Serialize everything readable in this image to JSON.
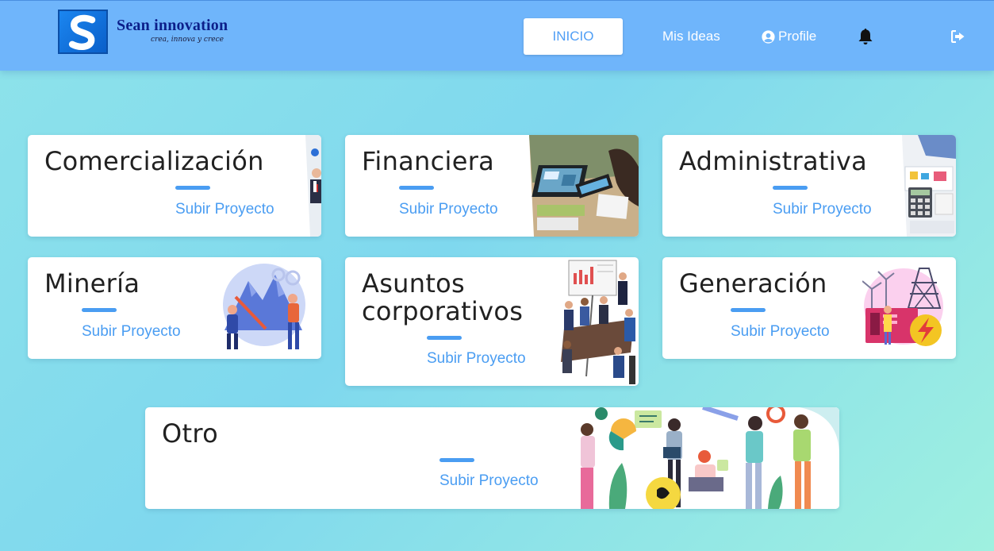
{
  "header": {
    "brand_name": "Sean innovation",
    "brand_tagline": "crea, innova y crece",
    "nav": {
      "inicio": "INICIO",
      "mis_ideas": "Mis Ideas",
      "profile": "Profile"
    },
    "icons": {
      "profile": "user-circle-icon",
      "notifications": "bell-icon",
      "logout": "sign-out-icon"
    }
  },
  "colors": {
    "header_bg": "#6fb5fb",
    "accent": "#4a9df2",
    "title_text": "#212121"
  },
  "categories": [
    {
      "title": "Comercialización",
      "action": "Subir Proyecto"
    },
    {
      "title": "Financiera",
      "action": "Subir Proyecto"
    },
    {
      "title": "Administrativa",
      "action": "Subir Proyecto"
    },
    {
      "title": "Minería",
      "action": "Subir Proyecto"
    },
    {
      "title_line1": "Asuntos",
      "title_line2": "corporativos",
      "action": "Subir Proyecto"
    },
    {
      "title": "Generación",
      "action": "Subir Proyecto"
    },
    {
      "title": "Otro",
      "action": "Subir Proyecto"
    }
  ]
}
